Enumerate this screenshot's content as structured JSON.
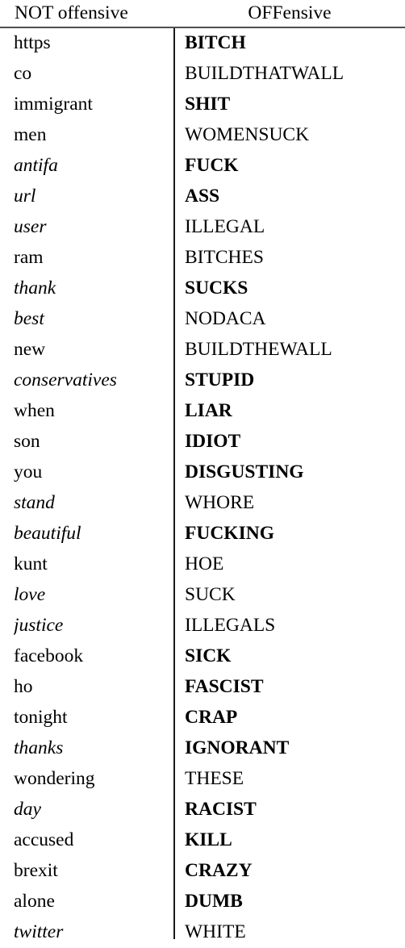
{
  "table": {
    "columns": [
      {
        "id": "not_offensive",
        "header": "NOT offensive",
        "align": "left"
      },
      {
        "id": "offensive",
        "header": "OFFensive",
        "align": "center"
      }
    ],
    "style_legend": {
      "plain": "regular upright serif",
      "italic": "italic serif",
      "bold": "bold serif"
    },
    "row_count": 29,
    "rows": [
      {
        "not_offensive": {
          "text": "https",
          "style": "plain"
        },
        "offensive": {
          "text": "BITCH",
          "style": "bold"
        }
      },
      {
        "not_offensive": {
          "text": "co",
          "style": "plain"
        },
        "offensive": {
          "text": "BUILDTHATWALL",
          "style": "plain"
        }
      },
      {
        "not_offensive": {
          "text": "immigrant",
          "style": "plain"
        },
        "offensive": {
          "text": "SHIT",
          "style": "bold"
        }
      },
      {
        "not_offensive": {
          "text": "men",
          "style": "plain"
        },
        "offensive": {
          "text": "WOMENSUCK",
          "style": "plain"
        }
      },
      {
        "not_offensive": {
          "text": "antifa",
          "style": "italic"
        },
        "offensive": {
          "text": "FUCK",
          "style": "bold"
        }
      },
      {
        "not_offensive": {
          "text": "url",
          "style": "italic"
        },
        "offensive": {
          "text": "ASS",
          "style": "bold"
        }
      },
      {
        "not_offensive": {
          "text": "user",
          "style": "italic"
        },
        "offensive": {
          "text": "ILLEGAL",
          "style": "plain"
        }
      },
      {
        "not_offensive": {
          "text": "ram",
          "style": "plain"
        },
        "offensive": {
          "text": "BITCHES",
          "style": "plain"
        }
      },
      {
        "not_offensive": {
          "text": "thank",
          "style": "italic"
        },
        "offensive": {
          "text": "SUCKS",
          "style": "bold"
        }
      },
      {
        "not_offensive": {
          "text": "best",
          "style": "italic"
        },
        "offensive": {
          "text": "NODACA",
          "style": "plain"
        }
      },
      {
        "not_offensive": {
          "text": "new",
          "style": "plain"
        },
        "offensive": {
          "text": "BUILDTHEWALL",
          "style": "plain"
        }
      },
      {
        "not_offensive": {
          "text": "conservatives",
          "style": "italic"
        },
        "offensive": {
          "text": "STUPID",
          "style": "bold"
        }
      },
      {
        "not_offensive": {
          "text": "when",
          "style": "plain"
        },
        "offensive": {
          "text": "LIAR",
          "style": "bold"
        }
      },
      {
        "not_offensive": {
          "text": "son",
          "style": "plain"
        },
        "offensive": {
          "text": "IDIOT",
          "style": "bold"
        }
      },
      {
        "not_offensive": {
          "text": "you",
          "style": "plain"
        },
        "offensive": {
          "text": "DISGUSTING",
          "style": "bold"
        }
      },
      {
        "not_offensive": {
          "text": "stand",
          "style": "italic"
        },
        "offensive": {
          "text": "WHORE",
          "style": "plain"
        }
      },
      {
        "not_offensive": {
          "text": "beautiful",
          "style": "italic"
        },
        "offensive": {
          "text": "FUCKING",
          "style": "bold"
        }
      },
      {
        "not_offensive": {
          "text": "kunt",
          "style": "plain"
        },
        "offensive": {
          "text": "HOE",
          "style": "plain"
        }
      },
      {
        "not_offensive": {
          "text": "love",
          "style": "italic"
        },
        "offensive": {
          "text": "SUCK",
          "style": "plain"
        }
      },
      {
        "not_offensive": {
          "text": "justice",
          "style": "italic"
        },
        "offensive": {
          "text": "ILLEGALS",
          "style": "plain"
        }
      },
      {
        "not_offensive": {
          "text": "facebook",
          "style": "plain"
        },
        "offensive": {
          "text": "SICK",
          "style": "bold"
        }
      },
      {
        "not_offensive": {
          "text": "ho",
          "style": "plain"
        },
        "offensive": {
          "text": "FASCIST",
          "style": "bold"
        }
      },
      {
        "not_offensive": {
          "text": "tonight",
          "style": "plain"
        },
        "offensive": {
          "text": "CRAP",
          "style": "bold"
        }
      },
      {
        "not_offensive": {
          "text": "thanks",
          "style": "italic"
        },
        "offensive": {
          "text": "IGNORANT",
          "style": "bold"
        }
      },
      {
        "not_offensive": {
          "text": "wondering",
          "style": "plain"
        },
        "offensive": {
          "text": "THESE",
          "style": "plain"
        }
      },
      {
        "not_offensive": {
          "text": "day",
          "style": "italic"
        },
        "offensive": {
          "text": "RACIST",
          "style": "bold"
        }
      },
      {
        "not_offensive": {
          "text": "accused",
          "style": "plain"
        },
        "offensive": {
          "text": "KILL",
          "style": "bold"
        }
      },
      {
        "not_offensive": {
          "text": "brexit",
          "style": "plain"
        },
        "offensive": {
          "text": "CRAZY",
          "style": "bold"
        }
      },
      {
        "not_offensive": {
          "text": "alone",
          "style": "plain"
        },
        "offensive": {
          "text": "DUMB",
          "style": "bold"
        }
      },
      {
        "not_offensive": {
          "text": "twitter",
          "style": "italic"
        },
        "offensive": {
          "text": "WHITE",
          "style": "plain"
        }
      }
    ]
  },
  "colors": {
    "text": "#000000",
    "background": "#ffffff",
    "header_rule": "#4f4f4f",
    "column_divider": "#1a1a1a"
  }
}
